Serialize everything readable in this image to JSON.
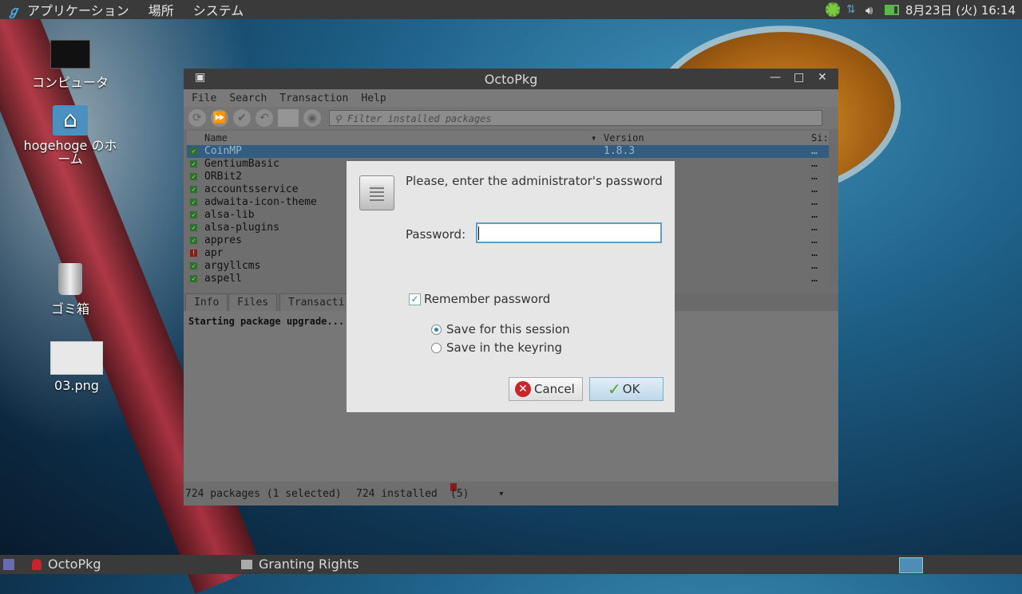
{
  "top_panel": {
    "menus": [
      "アプリケーション",
      "場所",
      "システム"
    ],
    "clock": "8月23日 (火) 16:14",
    "tray_icons": [
      "gear-icon",
      "network-icon",
      "volume-icon",
      "battery-icon"
    ]
  },
  "desktop_icons": [
    {
      "label": "コンピュータ",
      "icon": "computer-icon"
    },
    {
      "label": "hogehoge のホーム",
      "icon": "home-folder-icon"
    },
    {
      "label": "ゴミ箱",
      "icon": "trash-icon"
    },
    {
      "label": "03.png",
      "icon": "image-file-icon"
    }
  ],
  "window": {
    "title": "OctoPkg",
    "menu": [
      "File",
      "Search",
      "Transaction",
      "Help"
    ],
    "filter_placeholder": "Filter installed packages",
    "columns": {
      "name": "Name",
      "version": "Version",
      "size": "Si:"
    },
    "packages": [
      {
        "name": "CoinMP",
        "version": "1.8.3",
        "status": "installed",
        "selected": true
      },
      {
        "name": "GentiumBasic",
        "version": "",
        "status": "installed",
        "selected": false
      },
      {
        "name": "ORBit2",
        "version": "",
        "status": "installed",
        "selected": false
      },
      {
        "name": "accountsservice",
        "version": "",
        "status": "installed",
        "selected": false
      },
      {
        "name": "adwaita-icon-theme",
        "version": "",
        "status": "installed",
        "selected": false
      },
      {
        "name": "alsa-lib",
        "version": "",
        "status": "installed",
        "selected": false
      },
      {
        "name": "alsa-plugins",
        "version": "",
        "status": "installed",
        "selected": false
      },
      {
        "name": "appres",
        "version": "",
        "status": "installed",
        "selected": false
      },
      {
        "name": "apr",
        "version": "",
        "status": "outdated",
        "selected": false
      },
      {
        "name": "argyllcms",
        "version": "",
        "status": "installed",
        "selected": false
      },
      {
        "name": "aspell",
        "version": "",
        "status": "installed",
        "selected": false
      }
    ],
    "tabs": [
      "Info",
      "Files",
      "Transacti"
    ],
    "output_text": "Starting package upgrade...",
    "status": {
      "packages": "724 packages (1 selected)",
      "installed": "724 installed",
      "outdated": "(5)"
    }
  },
  "dialog": {
    "title": "Please, enter the administrator's password",
    "password_label": "Password:",
    "password_value": "",
    "remember_label": "Remember password",
    "remember_checked": true,
    "options": [
      {
        "label": "Save for this session",
        "selected": true
      },
      {
        "label": "Save in the keyring",
        "selected": false
      }
    ],
    "cancel_label": "Cancel",
    "ok_label": "OK"
  },
  "bottom_panel": {
    "tasks": [
      "OctoPkg",
      "Granting Rights"
    ]
  },
  "colors": {
    "accent": "#2a8ab8",
    "selected_row": "#325d80",
    "focus_border": "#5aa0c8"
  }
}
